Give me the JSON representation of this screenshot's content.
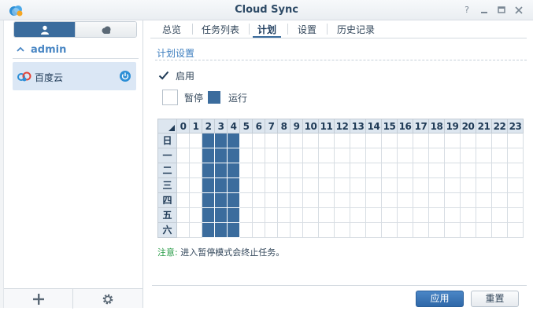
{
  "window": {
    "title": "Cloud Sync",
    "controls": [
      "help-icon",
      "minimize-icon",
      "maximize-icon",
      "close-icon"
    ]
  },
  "sidebar": {
    "segments": [
      {
        "name": "user-icon",
        "active": true
      },
      {
        "name": "cloud-icon",
        "active": false
      }
    ],
    "group": {
      "label": "admin",
      "expanded": true
    },
    "connections": [
      {
        "label": "百度云",
        "icon": "baidu-cloud-icon",
        "status_icon": "power-icon",
        "selected": true
      }
    ],
    "bottom_buttons": [
      {
        "icon": "add-icon",
        "glyph": "+"
      },
      {
        "icon": "gear-icon"
      }
    ]
  },
  "tabs": [
    {
      "label": "总览",
      "active": false
    },
    {
      "label": "任务列表",
      "active": false
    },
    {
      "label": "计划",
      "active": true
    },
    {
      "label": "设置",
      "active": false
    },
    {
      "label": "历史记录",
      "active": false
    }
  ],
  "schedule": {
    "section_title": "计划设置",
    "enable_label": "启用",
    "enabled": true,
    "legend": {
      "pause_label": "暂停",
      "run_label": "运行"
    },
    "hours": [
      "0",
      "1",
      "2",
      "3",
      "4",
      "5",
      "6",
      "7",
      "8",
      "9",
      "10",
      "11",
      "12",
      "13",
      "14",
      "15",
      "16",
      "17",
      "18",
      "19",
      "20",
      "21",
      "22",
      "23"
    ],
    "days": [
      "日",
      "一",
      "二",
      "三",
      "四",
      "五",
      "六"
    ],
    "run_hours": [
      2,
      3,
      4
    ],
    "note_label": "注意:",
    "note_text": " 进入暂停模式会终止任务。"
  },
  "footer": {
    "apply_label": "应用",
    "reset_label": "重置"
  },
  "colors": {
    "accent": "#3b6c9d",
    "link": "#3f7fbf",
    "note": "#2a9c48"
  }
}
